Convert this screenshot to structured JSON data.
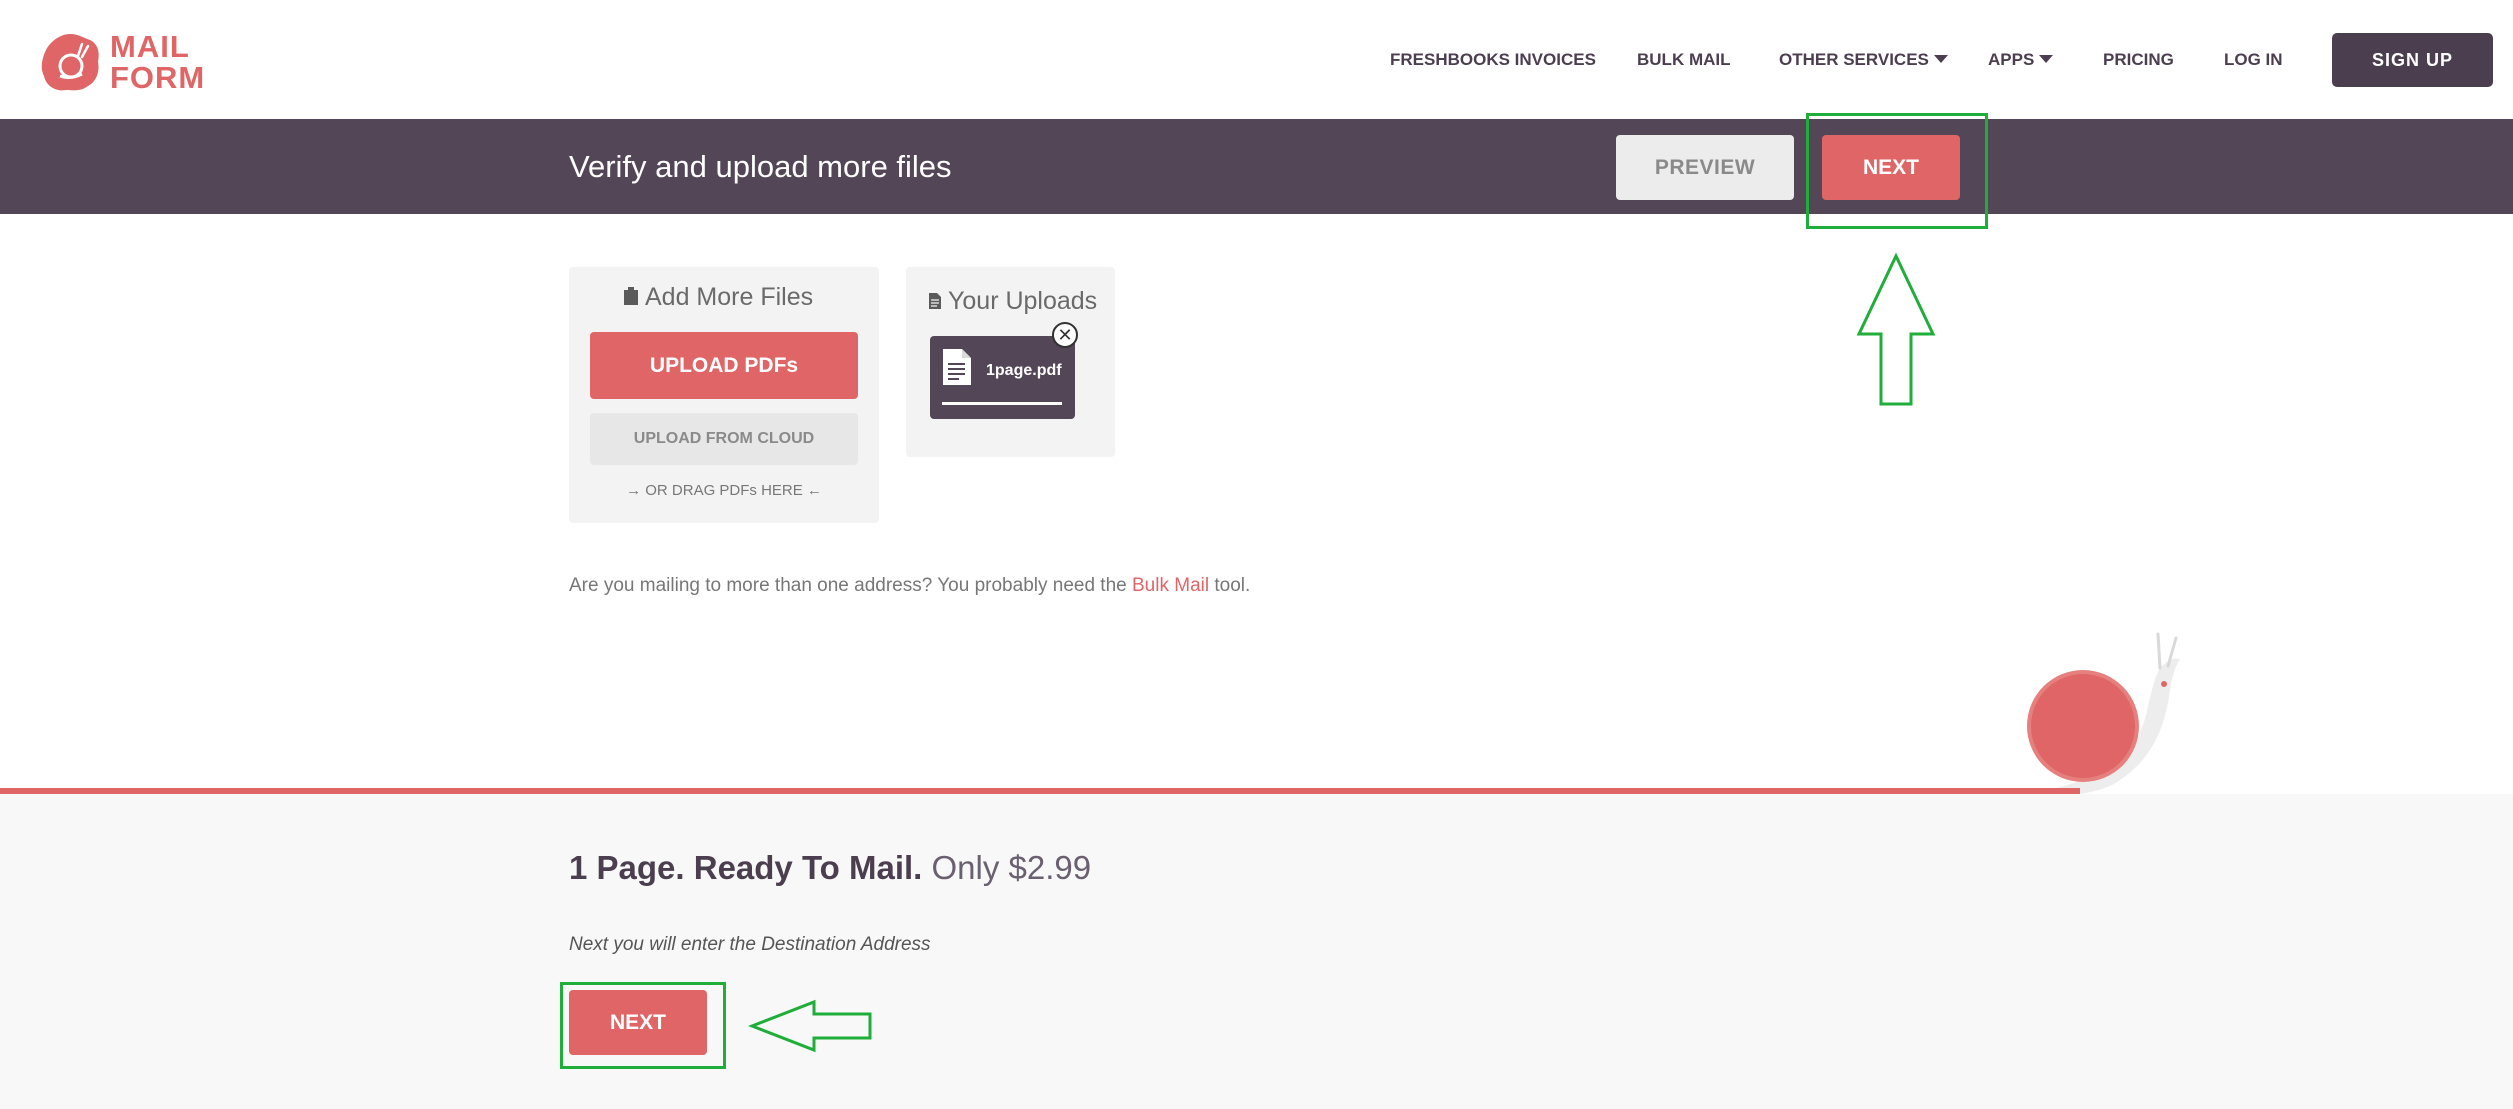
{
  "brand": {
    "line1": "MAIL",
    "line2": "FORM",
    "accent": "#e06566",
    "dark": "#4b3f4f"
  },
  "nav": {
    "freshbooks": "FRESHBOOKS INVOICES",
    "bulk_mail": "BULK MAIL",
    "other_services": "OTHER SERVICES",
    "apps": "APPS",
    "pricing": "PRICING",
    "login": "LOG IN",
    "signup": "SIGN UP"
  },
  "bar": {
    "title": "Verify and upload more files",
    "preview": "PREVIEW",
    "next": "NEXT"
  },
  "add_files": {
    "title": "Add More Files",
    "upload_pdfs": "UPLOAD PDFs",
    "upload_cloud": "UPLOAD FROM CLOUD",
    "drag_hint": "→ OR DRAG PDFs HERE ←"
  },
  "uploads": {
    "title": "Your Uploads",
    "files": [
      {
        "name": "1page.pdf"
      }
    ]
  },
  "note": {
    "before": "Are you mailing to more than one address? You probably need the ",
    "link": "Bulk Mail",
    "after": " tool."
  },
  "summary": {
    "pages": "1 Page. Ready To Mail.",
    "price": "Only $2.99",
    "next_hint": "Next you will enter the Destination Address",
    "next": "NEXT"
  }
}
